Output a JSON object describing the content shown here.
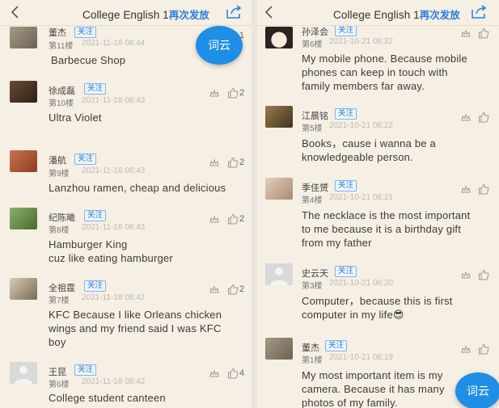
{
  "left": {
    "header": {
      "title": "College English 1",
      "repost_label": "再次发放"
    },
    "wordcloud_label": "词云",
    "partial_count": "1",
    "posts": [
      {
        "name": "董杰",
        "follow": "关注",
        "floor": "第11楼",
        "time": "2021-11-18 08:44",
        "likes": "",
        "content": [
          "Barbecue Shop"
        ]
      },
      {
        "name": "徐成磊",
        "follow": "关注",
        "floor": "第10楼",
        "time": "2021-11-18 08:43",
        "likes": "2",
        "content": [
          "Ultra Violet"
        ]
      },
      {
        "name": "潘航",
        "follow": "关注",
        "floor": "第9楼",
        "time": "2021-11-18 08:43",
        "likes": "2",
        "content": [
          "Lanzhou ramen, cheap and delicious"
        ]
      },
      {
        "name": "纪陈曦",
        "follow": "关注",
        "floor": "第8楼",
        "time": "2021-11-18 08:43",
        "likes": "2",
        "content": [
          "Hamburger King",
          "cuz like eating hamburger"
        ]
      },
      {
        "name": "全祖霆",
        "follow": "关注",
        "floor": "第7楼",
        "time": "2021-11-18 08:42",
        "likes": "2",
        "content": [
          "KFC Because I like Orleans chicken",
          "wings and my friend said I was KFC",
          "boy"
        ]
      },
      {
        "name": "王昆",
        "follow": "关注",
        "floor": "第6楼",
        "time": "2021-11-18 08:42",
        "likes": "4",
        "content": [
          "College student canteen"
        ]
      }
    ]
  },
  "right": {
    "header": {
      "title": "College English 1",
      "repost_label": "再次发放"
    },
    "wordcloud_label": "词云",
    "posts": [
      {
        "name": "孙泽会",
        "follow": "关注",
        "floor": "第6楼",
        "time": "2021-10-21 08:22",
        "likes": "",
        "content": [
          "My  mobile phone. Because mobile",
          "phones can keep in touch with",
          "family members far away."
        ]
      },
      {
        "name": "江晨铭",
        "follow": "关注",
        "floor": "第5楼",
        "time": "2021-10-21 08:22",
        "likes": "",
        "content": [
          "Books，cause i wanna be a",
          "knowledgeable person."
        ]
      },
      {
        "name": "季佳赟",
        "follow": "关注",
        "floor": "第4楼",
        "time": "2021-10-21 08:21",
        "likes": "",
        "content": [
          "The necklace is the most important",
          "to me because it is a birthday gift",
          "from my father"
        ]
      },
      {
        "name": "史云天",
        "follow": "关注",
        "floor": "第3楼",
        "time": "2021-10-21 08:20",
        "likes": "",
        "content": [
          "Computer，because this is first",
          "computer in my life😎"
        ]
      },
      {
        "name": "董杰",
        "follow": "关注",
        "floor": "第1楼",
        "time": "2021-10-21 08:19",
        "likes": "",
        "content": [
          "My most important item is my",
          "camera. Because it has many",
          "photos of my family."
        ]
      }
    ]
  },
  "colors": {
    "accent": "#2a7de1",
    "wordcloud_bg": "#1f8ee6",
    "panel_bg": "#f6efe3"
  },
  "icons": {
    "back": "chevron-left-icon",
    "share": "share-icon",
    "reward": "reward-icon",
    "like": "thumbs-up-icon"
  }
}
